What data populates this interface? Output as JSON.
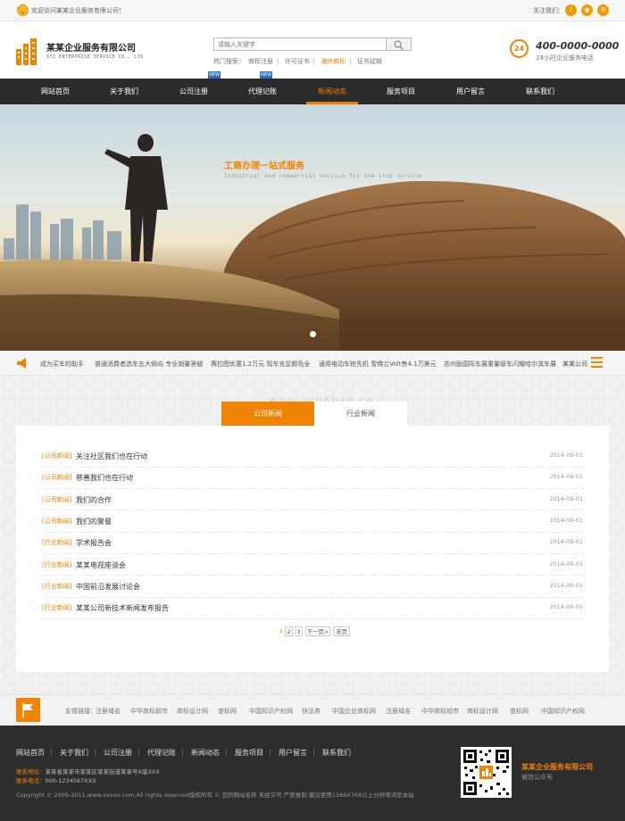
{
  "topbar": {
    "welcome": "欢迎访问某某企业服务有限公司！",
    "follow_label": "关注我们：",
    "social_icons": [
      "bell-icon",
      "weibo-icon",
      "wechat-icon"
    ]
  },
  "header": {
    "company_name": "某某企业服务有限公司",
    "company_en": "XYZ ENTERPRISE SERVICE CO., LTD",
    "search_placeholder": "请输入关键字",
    "hot_label": "热门搜索：",
    "hot_items": [
      "商标注册",
      "许可证书",
      "海外商标",
      "证书延期"
    ],
    "phone_icon_text": "24",
    "phone": "400-0000-0000",
    "phone_sub": "24小时企业服务电话"
  },
  "nav": {
    "items": [
      {
        "label": "网站首页"
      },
      {
        "label": "关于我们"
      },
      {
        "label": "公司注册"
      },
      {
        "label": "代理记账"
      },
      {
        "label": "新闻动态"
      },
      {
        "label": "服务项目"
      },
      {
        "label": "用户留言"
      },
      {
        "label": "联系我们"
      }
    ],
    "active": "新闻动态",
    "badge": "NEW"
  },
  "banner": {
    "title": "工商办理一站式服务",
    "subtitle": "Industrial and commercial service for one-stop service"
  },
  "ticker": {
    "items": [
      "成为买车的助手",
      "普通消费者选车五大倾向 专业销量答疑",
      "赛拉图优惠1.2万元 现车充足颜色全",
      "通用电动车抢先机 雪佛兰Volt售4.1万美元",
      "苏州励国际车展重量级车闪耀哈尔滨车展",
      "某某公司"
    ]
  },
  "news": {
    "tabs": [
      "公司新闻",
      "行业新闻"
    ],
    "watermark": "www.pruoban.cn",
    "items": [
      {
        "category": "[公司新闻]",
        "title": "关注社区我们也在行动",
        "date": "2014-09-01"
      },
      {
        "category": "[公司新闻]",
        "title": "慈善我们也在行动",
        "date": "2014-09-01"
      },
      {
        "category": "[公司新闻]",
        "title": "我们的合作",
        "date": "2014-09-01"
      },
      {
        "category": "[公司新闻]",
        "title": "我们的聚餐",
        "date": "2014-09-01"
      },
      {
        "category": "[行业新闻]",
        "title": "学术报告会",
        "date": "2014-09-01"
      },
      {
        "category": "[行业新闻]",
        "title": "某某电视座谈会",
        "date": "2014-09-01"
      },
      {
        "category": "[行业新闻]",
        "title": "中国前沿发展讨论会",
        "date": "2014-09-01"
      },
      {
        "category": "[行业新闻]",
        "title": "某某公司新技术新闻发布报告",
        "date": "2014-09-01"
      }
    ],
    "pager": {
      "current": "1",
      "pages": [
        "2",
        "3"
      ],
      "next": "下一页>",
      "last": "末页"
    }
  },
  "links": {
    "label": "友情链接：",
    "items": [
      "注册域名",
      "中华商标超市",
      "商标设计网",
      "查标网",
      "中国知识产权网",
      "快法务",
      "中国企业商标网",
      "注册域名",
      "中华商标超市",
      "商标设计网",
      "查标网",
      "中国知识产权网"
    ]
  },
  "footer": {
    "nav": [
      "网站首页",
      "关于我们",
      "公司注册",
      "代理记账",
      "新闻动态",
      "服务项目",
      "用户留言",
      "联系我们"
    ],
    "nav_sep": "|",
    "address_label": "联系地址：",
    "address": "某某省某某市某某区某某街道某某号X座XXX",
    "phone_label": "联系电话：",
    "phone": "000-1234567XXX",
    "copyright": "Copyright © 2009-2011,www.xxxxx.com,All rights reserved版权所有 © 您的网站名称 未经许可 严禁复制 建议使用1366X768以上分辨率浏览本站",
    "qr_company": "某某企业服务有限公司",
    "qr_sub": "微信公众号"
  }
}
